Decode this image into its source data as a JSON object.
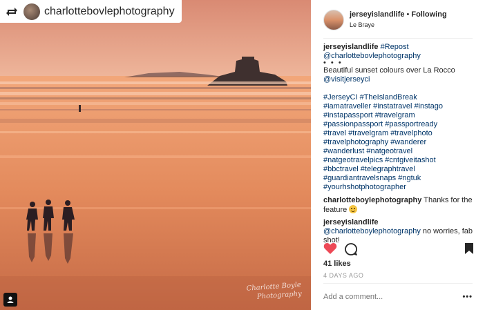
{
  "photo": {
    "repost_username": "charlottebovlephotography",
    "watermark_line1": "Charlotte Boyle",
    "watermark_line2": "Photography"
  },
  "header": {
    "username": "jerseyislandlife",
    "separator": "•",
    "follow_status": "Following",
    "location": "Le Braye"
  },
  "caption": {
    "username": "jerseyislandlife",
    "line1_tag": "#Repost",
    "line2_mention": "@charlottebovlephotography",
    "dots": "• • •",
    "text": "Beautiful sunset colours over La Rocco",
    "mention": "@visitjerseyci",
    "hashtag_lines": [
      "#JerseyCI #TheIslandBreak",
      "#iamatraveller #instatravel #instago",
      "#instapassport #travelgram",
      "#passionpassport #passportready",
      "#travel #travelgram #travelphoto",
      "#travelphotography #wanderer",
      "#wanderlust #natgeotravel",
      "#natgeotravelpics #cntgiveitashot",
      "#bbctravel #telegraphtravel",
      "#guardiantravelsnaps #ngtuk",
      "#yourhshotphotographer"
    ]
  },
  "comments": [
    {
      "username": "charlotteboylephotography",
      "text": "Thanks for the feature"
    },
    {
      "username": "jerseyislandlife",
      "mention_part1": "@charlotteboylephotogr",
      "mention_part2": "aphy",
      "text": "no worries, fab shot!"
    }
  ],
  "likes": "41 likes",
  "date": "4 DAYS AGO",
  "comment_placeholder": "Add a comment...",
  "more_label": "•••",
  "colors": {
    "heart": "#ed4956",
    "link": "#003569",
    "muted": "#999999"
  }
}
